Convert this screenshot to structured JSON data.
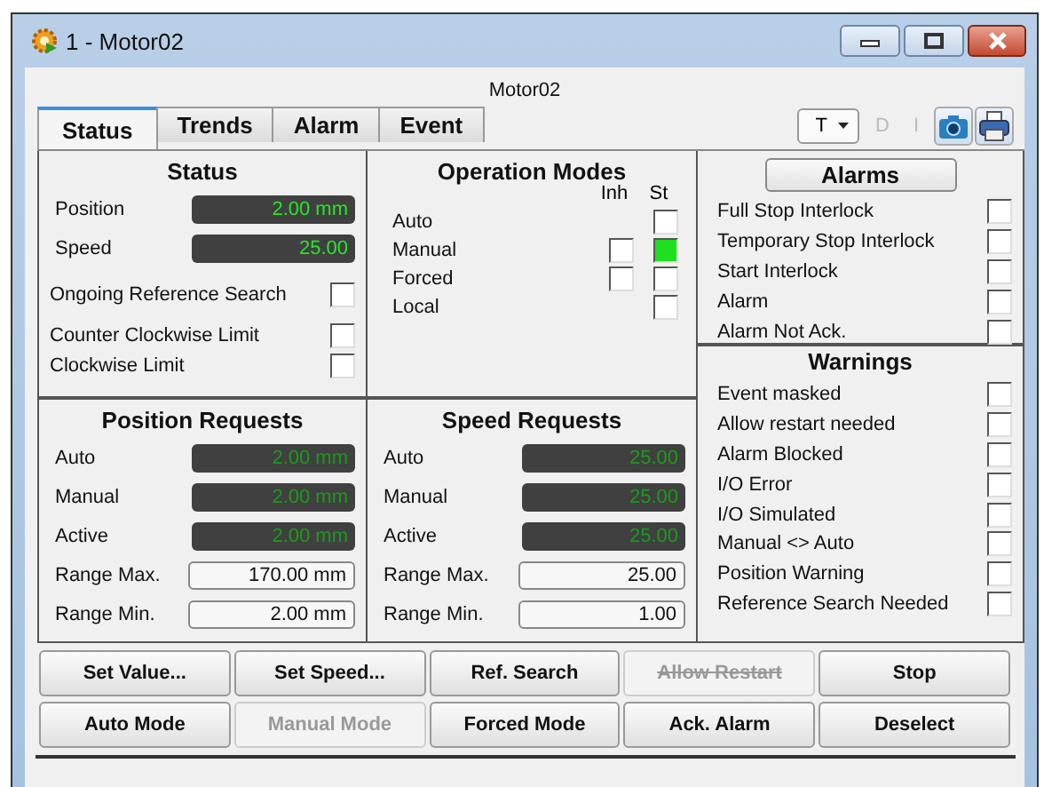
{
  "window": {
    "title": "1 - Motor02"
  },
  "header": "Motor02",
  "tabs": [
    {
      "label": "Status",
      "selected": true
    },
    {
      "label": "Trends",
      "selected": false
    },
    {
      "label": "Alarm",
      "selected": false
    },
    {
      "label": "Event",
      "selected": false
    }
  ],
  "toolbar": {
    "dropdown": "T",
    "buttons": [
      {
        "label": "D",
        "disabled": true
      },
      {
        "label": "I",
        "disabled": true
      }
    ]
  },
  "status": {
    "title": "Status",
    "values": [
      {
        "label": "Position",
        "value": "2.00 mm"
      },
      {
        "label": "Speed",
        "value": "25.00"
      }
    ],
    "flags": [
      {
        "label": "Ongoing Reference Search",
        "checked": false
      },
      {
        "label": "Counter Clockwise Limit",
        "checked": false
      },
      {
        "label": "Clockwise Limit",
        "checked": false
      }
    ]
  },
  "operation_modes": {
    "title": "Operation Modes",
    "columns": [
      "Inh",
      "St"
    ],
    "modes": [
      {
        "label": "Auto",
        "active": false
      },
      {
        "label": "Manual",
        "inhibited": false,
        "active": true
      },
      {
        "label": "Forced",
        "inhibited": false,
        "active": false
      },
      {
        "label": "Local",
        "active": false
      }
    ]
  },
  "alarms": {
    "title": "Alarms",
    "items": [
      {
        "label": "Full Stop Interlock",
        "active": false
      },
      {
        "label": "Temporary Stop Interlock",
        "active": false
      },
      {
        "label": "Start Interlock",
        "active": false
      },
      {
        "label": "Alarm",
        "active": false
      },
      {
        "label": "Alarm Not Ack.",
        "active": false
      }
    ]
  },
  "position_requests": {
    "title": "Position Requests",
    "values": [
      {
        "label": "Auto",
        "value": "2.00 mm"
      },
      {
        "label": "Manual",
        "value": "2.00 mm"
      },
      {
        "label": "Active",
        "value": "2.00 mm"
      }
    ],
    "ranges": [
      {
        "label": "Range Max.",
        "value": "170.00 mm"
      },
      {
        "label": "Range Min.",
        "value": "2.00 mm"
      }
    ]
  },
  "speed_requests": {
    "title": "Speed Requests",
    "values": [
      {
        "label": "Auto",
        "value": "25.00"
      },
      {
        "label": "Manual",
        "value": "25.00"
      },
      {
        "label": "Active",
        "value": "25.00"
      }
    ],
    "ranges": [
      {
        "label": "Range Max.",
        "value": "25.00"
      },
      {
        "label": "Range Min.",
        "value": "1.00"
      }
    ]
  },
  "warnings": {
    "title": "Warnings",
    "items": [
      {
        "label": "Event masked",
        "active": false
      },
      {
        "label": "Allow restart needed",
        "active": false
      },
      {
        "label": "Alarm Blocked",
        "active": false
      },
      {
        "label": "I/O Error",
        "active": false
      },
      {
        "label": "I/O Simulated",
        "active": false
      },
      {
        "label": "Manual <> Auto",
        "active": false
      },
      {
        "label": "Position Warning",
        "active": false
      },
      {
        "label": "Reference Search Needed",
        "active": false
      }
    ]
  },
  "buttons": [
    {
      "label": "Set Value...",
      "disabled": false,
      "struck_out": false
    },
    {
      "label": "Set Speed...",
      "disabled": false,
      "struck_out": false
    },
    {
      "label": "Ref. Search",
      "disabled": false,
      "struck_out": false
    },
    {
      "label": "Allow Restart",
      "disabled": true,
      "struck_out": true
    },
    {
      "label": "Stop",
      "disabled": false,
      "struck_out": false
    },
    {
      "label": "Auto Mode",
      "disabled": false,
      "struck_out": false
    },
    {
      "label": "Manual Mode",
      "disabled": true,
      "struck_out": false
    },
    {
      "label": "Forced Mode",
      "disabled": false,
      "struck_out": false
    },
    {
      "label": "Ack. Alarm",
      "disabled": false,
      "struck_out": false
    },
    {
      "label": "Deselect",
      "disabled": false,
      "struck_out": false
    }
  ]
}
